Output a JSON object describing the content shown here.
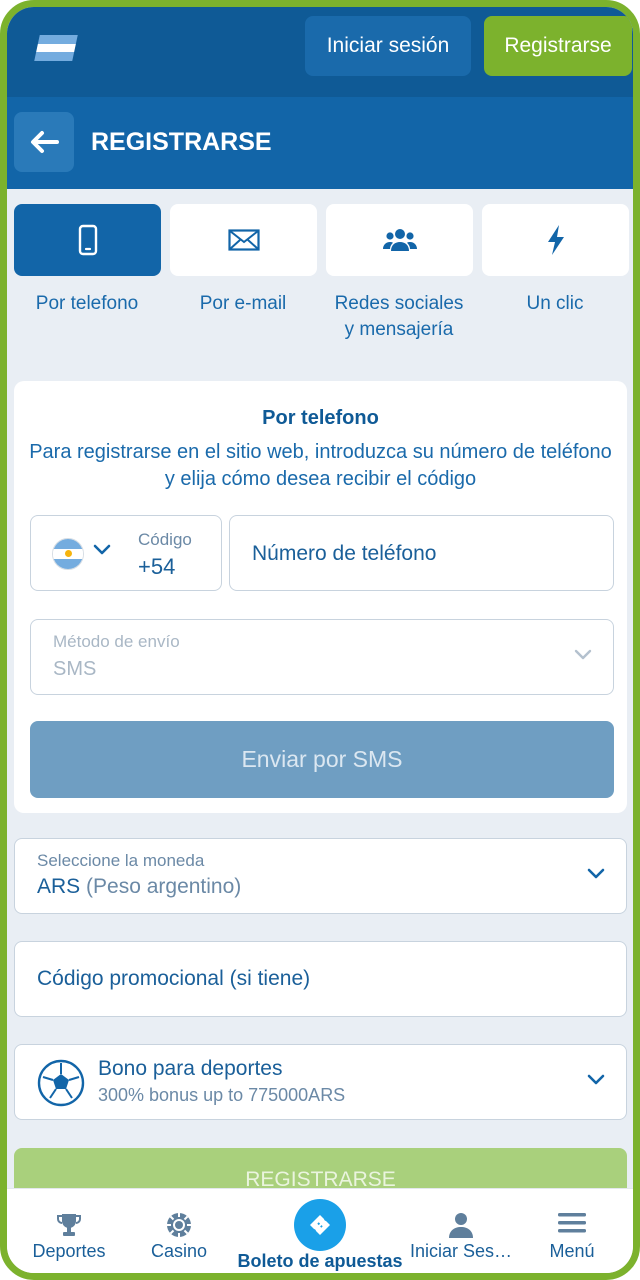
{
  "header": {
    "login_label": "Iniciar sesión",
    "register_label": "Registrarse"
  },
  "titlebar": {
    "title": "REGISTRARSE"
  },
  "tabs": [
    {
      "label": "Por telefono",
      "icon": "phone-icon",
      "active": true
    },
    {
      "label": "Por e-mail",
      "icon": "envelope-icon",
      "active": false
    },
    {
      "label_line1": "Redes sociales",
      "label_line2": "y mensajería",
      "icon": "users-icon",
      "active": false
    },
    {
      "label": "Un clic",
      "icon": "lightning-icon",
      "active": false
    }
  ],
  "form": {
    "title": "Por telefono",
    "description": "Para registrarse en el sitio web, introduzca su número de teléfono y elija cómo desea recibir el código",
    "code_label": "Código",
    "code_value": "+54",
    "phone_placeholder": "Número de teléfono",
    "method_label": "Método de envío",
    "method_value": "SMS",
    "send_label": "Enviar por SMS"
  },
  "currency": {
    "label": "Seleccione la moneda",
    "code": "ARS",
    "name": "(Peso argentino)"
  },
  "promo": {
    "placeholder": "Código promocional (si tiene)"
  },
  "bonus": {
    "title": "Bono para deportes",
    "subtitle": "300% bonus up to 775000ARS"
  },
  "register_button": {
    "label": "REGISTRARSE"
  },
  "nav": {
    "sports": "Deportes",
    "casino": "Casino",
    "betslip": "Boleto de apuestas",
    "login": "Iniciar Ses…",
    "menu": "Menú"
  },
  "colors": {
    "header_bg": "#0f5a96",
    "accent_green": "#7cb22d",
    "primary_blue": "#1265a8",
    "flag_light_blue": "#74acdf"
  }
}
